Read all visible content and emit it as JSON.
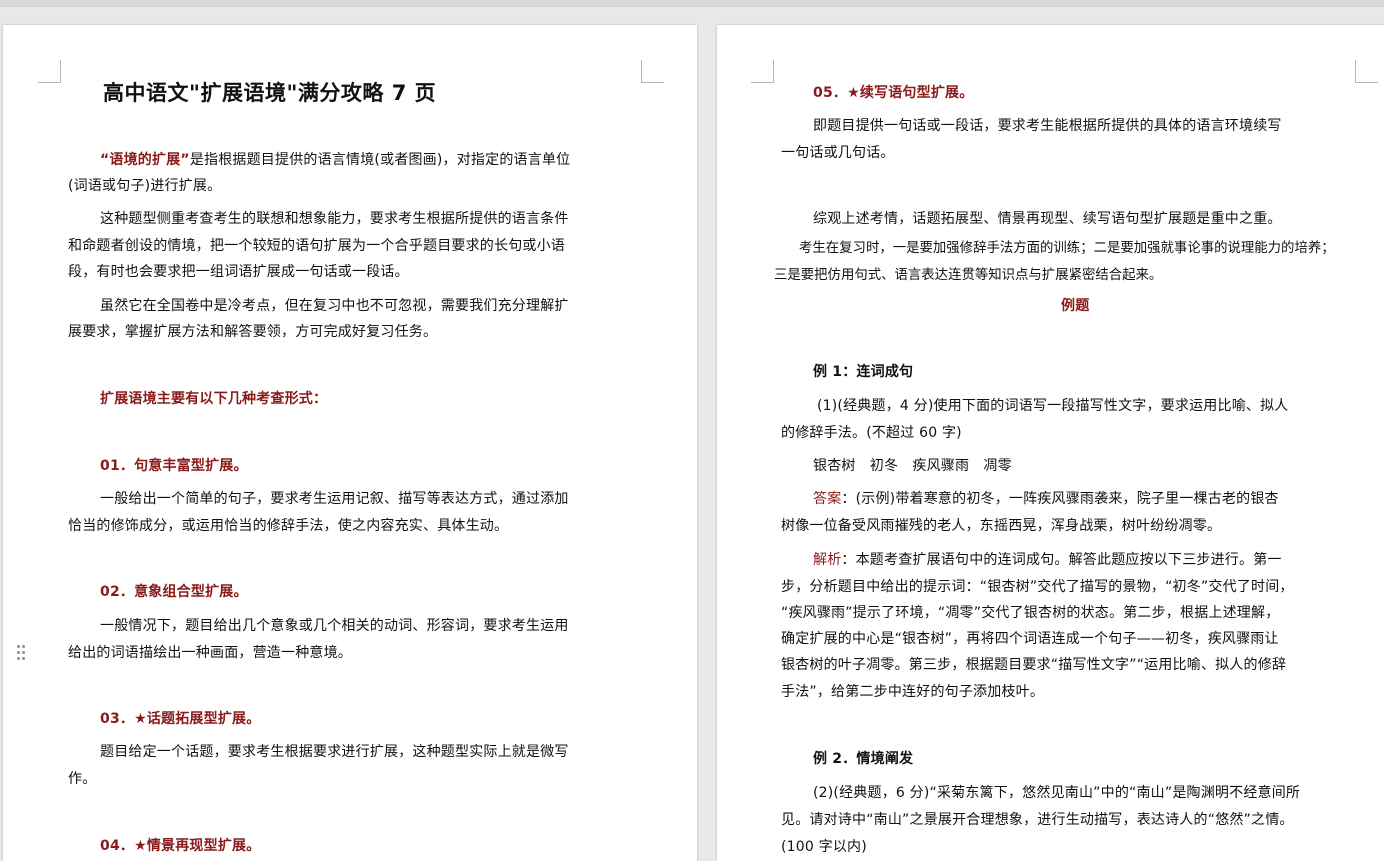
{
  "page1": {
    "title": "高中语文\"扩展语境\"满分攻略 7 页",
    "intro_term": "“语境的扩展”",
    "intro_line1_rest": "是指根据题目提供的语言情境(或者图画)，对指定的语言单位",
    "intro_line2": "(词语或句子)进行扩展。",
    "para2_line1": "这种题型侧重考查考生的联想和想象能力，要求考生根据所提供的语言条件",
    "para2_line2": "和命题者创设的情境，把一个较短的语句扩展为一个合乎题目要求的长句或小语",
    "para2_line3": "段，有时也会要求把一组词语扩展成一句话或一段话。",
    "para3_line1": "虽然它在全国卷中是冷考点，但在复习中也不可忽视，需要我们充分理解扩",
    "para3_line2": "展要求，掌握扩展方法和解答要领，方可完成好复习任务。",
    "forms_heading": "扩展语境主要有以下几种考查形式：",
    "s01_heading": "01．句意丰富型扩展。",
    "s01_line1": "一般给出一个简单的句子，要求考生运用记叙、描写等表达方式，通过添加",
    "s01_line2": "恰当的修饰成分，或运用恰当的修辞手法，使之内容充实、具体生动。",
    "s02_heading": "02．意象组合型扩展。",
    "s02_line1": "一般情况下，题目给出几个意象或几个相关的动词、形容词，要求考生运用",
    "s02_line2": "给出的词语描绘出一种画面，营造一种意境。",
    "s03_heading": "03．★话题拓展型扩展。",
    "s03_line1": "题目给定一个话题，要求考生根据要求进行扩展，这种题型实际上就是微写",
    "s03_line2": "作。",
    "s04_heading": "04．★情景再现型扩展。"
  },
  "page2": {
    "s05_heading": "05．★续写语句型扩展。",
    "s05_line1": "即题目提供一句话或一段话，要求考生能根据所提供的具体的语言环境续写",
    "s05_line2": "一句话或几句话。",
    "summary_line": "综观上述考情，话题拓展型、情景再现型、续写语句型扩展题是重中之重。",
    "advice_line1": "考生在复习时，一是要加强修辞手法方面的训练；二是要加强就事论事的说理能力的培养；",
    "advice_line2": "三是要把仿用句式、语言表达连贯等知识点与扩展紧密结合起来。",
    "examples_heading": "例题",
    "ex1_heading": "例 1：连词成句",
    "ex1_q_line1": "(1)(经典题，4 分)使用下面的词语写一段描写性文字，要求运用比喻、拟人",
    "ex1_q_line2": "的修辞手法。(不超过 60 字)",
    "ex1_words": "银杏树　初冬　疾风骤雨　凋零",
    "answer_label": "答案",
    "ex1_answer_line1": "：(示例)带着寒意的初冬，一阵疾风骤雨袭来，院子里一棵古老的银杏",
    "ex1_answer_line2": "树像一位备受风雨摧残的老人，东摇西晃，浑身战栗，树叶纷纷凋零。",
    "analysis_label": "解析",
    "ex1_analysis_line1": "：本题考查扩展语句中的连词成句。解答此题应按以下三步进行。第一",
    "ex1_analysis_line2": "步，分析题目中给出的提示词：“银杏树”交代了描写的景物，“初冬”交代了时间，",
    "ex1_analysis_line3": "“疾风骤雨”提示了环境，“凋零”交代了银杏树的状态。第二步，根据上述理解，",
    "ex1_analysis_line4": "确定扩展的中心是“银杏树”，再将四个词语连成一个句子——初冬，疾风骤雨让",
    "ex1_analysis_line5": "银杏树的叶子凋零。第三步，根据题目要求“描写性文字”“运用比喻、拟人的修辞",
    "ex1_analysis_line6": "手法”，给第二步中连好的句子添加枝叶。",
    "ex2_heading": "例 2．情境阐发",
    "ex2_q_line1": "(2)(经典题，6 分)“采菊东篱下，悠然见南山”中的“南山”是陶渊明不经意间所",
    "ex2_q_line2": "见。请对诗中“南山”之景展开合理想象，进行生动描写，表达诗人的“悠然”之情。",
    "ex2_q_line3": "(100 字以内)"
  }
}
